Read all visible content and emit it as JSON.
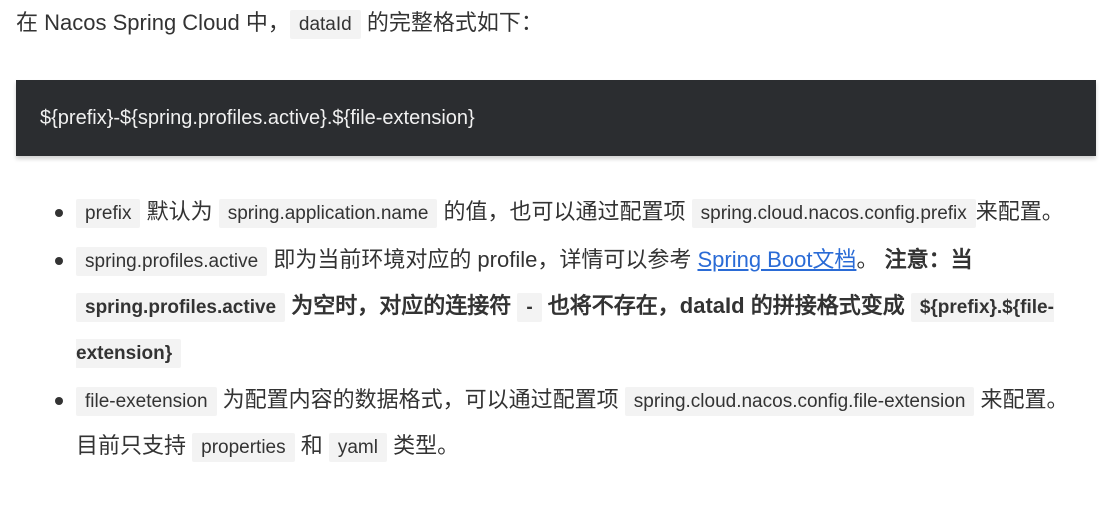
{
  "intro": {
    "prefix": "在 Nacos Spring Cloud 中，",
    "code": "dataId",
    "suffix": " 的完整格式如下："
  },
  "code_block": {
    "text": "${prefix}-${spring.profiles.active}.${file-extension}"
  },
  "items": [
    {
      "code1": "prefix",
      "text1": " 默认为 ",
      "code2": "spring.application.name",
      "text2": " 的值，也可以通过配置项 ",
      "code3": "spring.cloud.nacos.config.prefix",
      "text3": "来配置。"
    },
    {
      "code1": "spring.profiles.active",
      "text1": " 即为当前环境对应的 profile，详情可以参考 ",
      "link": "Spring Boot文档",
      "text2": "。 ",
      "note_prefix": "注意：当 ",
      "note_code1": "spring.profiles.active",
      "note_mid1": " 为空时，对应的连接符 ",
      "note_code2": "-",
      "note_mid2": " 也将不存在，dataId 的拼接格式变成 ",
      "note_code3": "${prefix}.${file-extension}"
    },
    {
      "code1": "file-exetension",
      "text1": " 为配置内容的数据格式，可以通过配置项 ",
      "code2": "spring.cloud.nacos.config.file-extension",
      "text2": " 来配置。目前只支持 ",
      "code3": "properties",
      "text3": " 和 ",
      "code4": "yaml",
      "text4": " 类型。"
    }
  ]
}
